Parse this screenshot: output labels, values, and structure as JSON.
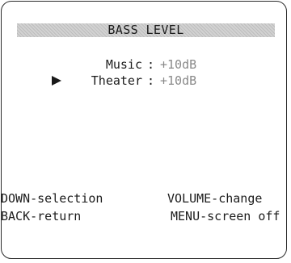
{
  "title": "BASS LEVEL",
  "rows": [
    {
      "label": "Music",
      "separator": ":",
      "value": "+10dB",
      "selected": false
    },
    {
      "label": "Theater",
      "separator": ":",
      "value": "+10dB",
      "selected": true
    }
  ],
  "help": {
    "line1_left": "DOWN-selection",
    "line1_right": "VOLUME-change",
    "line2_left": "BACK-return",
    "line2_right": "MENU-screen off"
  },
  "icons": {
    "selection_pointer": "play-triangle-icon"
  },
  "colors": {
    "value_text": "#8a8a8a",
    "title_bar": "#d2d2d2"
  }
}
